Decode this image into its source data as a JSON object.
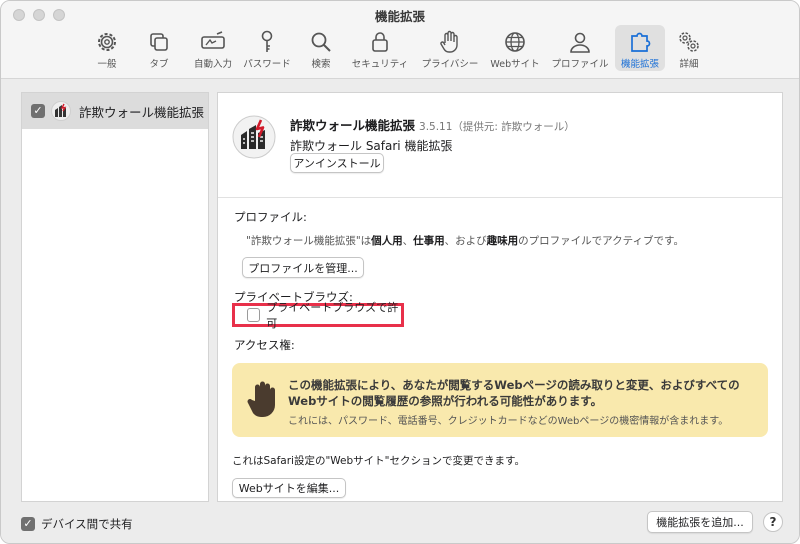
{
  "window": {
    "title": "機能拡張"
  },
  "toolbar": {
    "items": [
      {
        "label": "一般",
        "icon": "gear-icon"
      },
      {
        "label": "タブ",
        "icon": "tabs-icon"
      },
      {
        "label": "自動入力",
        "icon": "autofill-icon"
      },
      {
        "label": "パスワード",
        "icon": "key-icon"
      },
      {
        "label": "検索",
        "icon": "search-icon"
      },
      {
        "label": "セキュリティ",
        "icon": "lock-icon"
      },
      {
        "label": "プライバシー",
        "icon": "hand-icon"
      },
      {
        "label": "Webサイト",
        "icon": "globe-icon"
      },
      {
        "label": "プロファイル",
        "icon": "person-icon"
      },
      {
        "label": "機能拡張",
        "icon": "puzzle-icon",
        "active": true
      },
      {
        "label": "詳細",
        "icon": "gears-icon"
      }
    ],
    "accent": "#1a6fd6"
  },
  "sidebar": {
    "items": [
      {
        "name": "詐欺ウォール機能拡張",
        "checked": true
      }
    ]
  },
  "extension": {
    "title": "詐欺ウォール機能拡張",
    "version": "3.5.11（提供元: 詐欺ウォール）",
    "subtitle": "詐欺ウォール Safari 機能拡張",
    "uninstall_label": "アンインストール"
  },
  "profiles": {
    "heading": "プロファイル:",
    "desc_prefix": "\"詐欺ウォール機能拡張\"は",
    "p1": "個人用",
    "sep1": "、",
    "p2": "仕事用",
    "sep2": "、および",
    "p3": "趣味用",
    "desc_suffix": "のプロファイルでアクティブです。",
    "manage_label": "プロファイルを管理..."
  },
  "private_browsing": {
    "heading": "プライベートブラウズ:",
    "checkbox_label": "プライベートブラウズで許可",
    "checked": false,
    "highlight_color": "#e8304a"
  },
  "access": {
    "heading": "アクセス権:",
    "warning_line1": "この機能拡張により、あなたが閲覧するWebページの読み取りと変更、およびすべての",
    "warning_line2": "Webサイトの閲覧履歴の参照が行われる可能性があります。",
    "warning_line3": "これには、パスワード、電話番号、クレジットカードなどのWebページの機密情報が含まれます。",
    "warning_bg": "#f9e9ad"
  },
  "note": "これはSafari設定の\"Webサイト\"セクションで変更できます。",
  "edit_sites_label": "Webサイトを編集...",
  "footer": {
    "share_label": "デバイス間で共有",
    "share_checked": true,
    "add_label": "機能拡張を追加...",
    "help_label": "?"
  }
}
